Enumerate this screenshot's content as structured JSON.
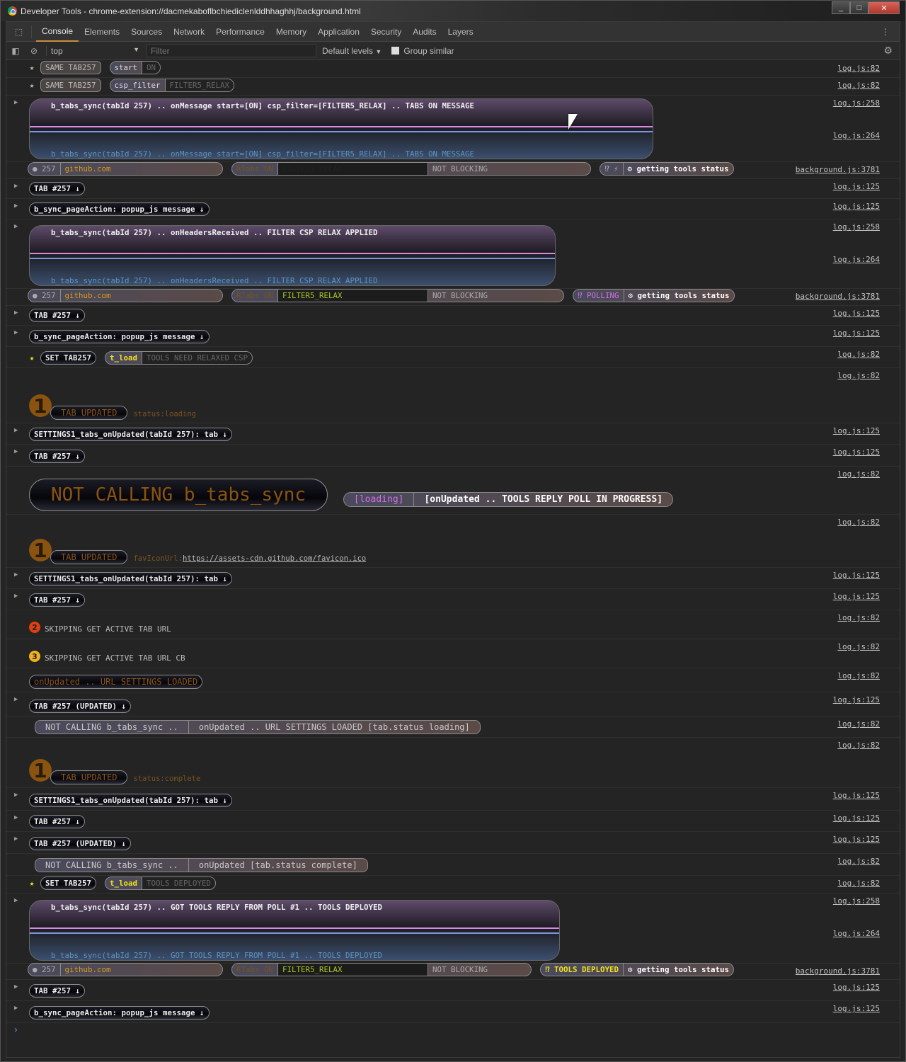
{
  "window": {
    "title": "Developer Tools - chrome-extension://dacmekaboflbchiediclenlddhhaghhj/background.html",
    "buttons": [
      "minimize",
      "maximize",
      "close"
    ]
  },
  "tabs": [
    "Console",
    "Elements",
    "Sources",
    "Network",
    "Performance",
    "Memory",
    "Application",
    "Security",
    "Audits",
    "Layers"
  ],
  "active_tab": "Console",
  "toolbar": {
    "context": "top",
    "filter_placeholder": "Filter",
    "levels": "Default levels",
    "group_similar": "Group similar",
    "group_similar_checked": false
  },
  "rows": [
    {
      "src": [
        "log.js:82"
      ],
      "parts": [
        {
          "t": "star",
          "color": "#bbbbbb"
        },
        {
          "t": "pill",
          "v": "gray",
          "text": "SAME TAB257"
        },
        {
          "t": "group",
          "segs": [
            {
              "text": "start"
            },
            {
              "text": "ON",
              "v": "dark"
            }
          ]
        }
      ]
    },
    {
      "src": [
        "log.js:82"
      ],
      "parts": [
        {
          "t": "star",
          "color": "#bbbbbb"
        },
        {
          "t": "pill",
          "v": "gray",
          "text": "SAME TAB257"
        },
        {
          "t": "group",
          "segs": [
            {
              "text": "csp_filter"
            },
            {
              "text": "FILTER5_RELAX",
              "v": "dark"
            }
          ]
        }
      ]
    },
    {
      "src": [
        "log.js:258",
        "log.js:264"
      ],
      "expand": true,
      "parts": [
        {
          "t": "block",
          "text": "b_tabs_sync(tabId 257) .. onMessage start=[ON] csp_filter=[FILTER5_RELAX] .. TABS ON MESSAGE"
        }
      ]
    },
    {
      "src": [
        "background.js:3781"
      ],
      "parts": [
        {
          "t": "status",
          "tab": "● 257",
          "host": "github.com",
          "rtabs": "RTabs ON",
          "filter": "FILTER5_RELAX",
          "filter_v": "c-dim",
          "block": "NOT BLOCKING",
          "state": "⁉ ⚡",
          "state_v": "c-gray",
          "tools": "⚙ getting tools status"
        }
      ]
    },
    {
      "src": [
        "log.js:125"
      ],
      "expand": true,
      "parts": [
        {
          "t": "pill",
          "text": "TAB #257 ↓"
        }
      ]
    },
    {
      "src": [
        "log.js:125"
      ],
      "expand": true,
      "parts": [
        {
          "t": "pill",
          "text": "b_sync_pageAction: popup_js message ↓"
        }
      ]
    },
    {
      "src": [
        "log.js:258",
        "log.js:264"
      ],
      "expand": true,
      "parts": [
        {
          "t": "block",
          "text": "b_tabs_sync(tabId 257) .. onHeadersReceived .. FILTER CSP RELAX APPLIED"
        }
      ]
    },
    {
      "src": [
        "background.js:3781"
      ],
      "parts": [
        {
          "t": "status",
          "tab": "● 257",
          "host": "github.com",
          "rtabs": "RTabs ON",
          "filter": "FILTER5_RELAX",
          "filter_v": "c-lime",
          "block": "NOT BLOCKING",
          "state": "⁉ POLLING",
          "state_v": "c-purple",
          "tools": "⚙ getting tools status"
        }
      ]
    },
    {
      "src": [
        "log.js:125"
      ],
      "expand": true,
      "parts": [
        {
          "t": "pill",
          "text": "TAB #257 ↓"
        }
      ]
    },
    {
      "src": [
        "log.js:125"
      ],
      "expand": true,
      "parts": [
        {
          "t": "pill",
          "text": "b_sync_pageAction: popup_js message ↓"
        }
      ]
    },
    {
      "src": [
        "log.js:82"
      ],
      "parts": [
        {
          "t": "star",
          "color": "#f0e020"
        },
        {
          "t": "pill",
          "text": "SET TAB257"
        },
        {
          "t": "group",
          "segs": [
            {
              "text": "t_load",
              "v": "c-yellow"
            },
            {
              "text": "TOOLS NEED RELAXED CSP",
              "v": "dark"
            }
          ]
        }
      ]
    },
    {
      "src": [
        "log.js:82"
      ],
      "parts": [
        {
          "t": "num",
          "text": "1"
        },
        {
          "t": "tabupdated",
          "text": "TAB UPDATED"
        },
        {
          "t": "small",
          "text": "status:loading"
        }
      ]
    },
    {
      "src": [
        "log.js:125"
      ],
      "expand": true,
      "parts": [
        {
          "t": "pill",
          "text": "SETTINGS1_tabs_onUpdated(tabId 257): tab ↓"
        }
      ]
    },
    {
      "src": [
        "log.js:125"
      ],
      "expand": true,
      "parts": [
        {
          "t": "pill",
          "text": "TAB #257 ↓"
        }
      ]
    },
    {
      "src": [
        "log.js:82"
      ],
      "parts": [
        {
          "t": "bignc",
          "text": "NOT CALLING b_tabs_sync"
        },
        {
          "t": "group",
          "big": true,
          "segs": [
            {
              "text": "[loading]",
              "v": "c-purple"
            },
            {
              "text": "[onUpdated .. TOOLS REPLY POLL IN PROGRESS]",
              "v": "bold"
            }
          ]
        }
      ]
    },
    {
      "src": [
        "log.js:82"
      ],
      "parts": [
        {
          "t": "num",
          "text": "1"
        },
        {
          "t": "tabupdated",
          "text": "TAB UPDATED"
        },
        {
          "t": "small",
          "text": "favIconUrl:",
          "link": "https://assets-cdn.github.com/favicon.ico"
        }
      ]
    },
    {
      "src": [
        "log.js:125"
      ],
      "expand": true,
      "parts": [
        {
          "t": "pill",
          "text": "SETTINGS1_tabs_onUpdated(tabId 257): tab ↓"
        }
      ]
    },
    {
      "src": [
        "log.js:125"
      ],
      "expand": true,
      "parts": [
        {
          "t": "pill",
          "text": "TAB #257 ↓"
        }
      ]
    },
    {
      "src": [
        "log.js:82"
      ],
      "parts": [
        {
          "t": "dot",
          "text": "2",
          "color": "#e04010"
        },
        {
          "t": "plain",
          "text": "SKIPPING GET ACTIVE TAB URL"
        }
      ]
    },
    {
      "src": [
        "log.js:82"
      ],
      "parts": [
        {
          "t": "dot",
          "text": "3",
          "color": "#f0b020"
        },
        {
          "t": "plain",
          "text": "SKIPPING GET ACTIVE TAB URL CB"
        }
      ]
    },
    {
      "src": [
        "log.js:82"
      ],
      "parts": [
        {
          "t": "urlpill",
          "text": "onUpdated .. URL SETTINGS LOADED"
        }
      ]
    },
    {
      "src": [
        "log.js:125"
      ],
      "expand": true,
      "parts": [
        {
          "t": "pill",
          "text": "TAB #257 (UPDATED) ↓"
        }
      ]
    },
    {
      "src": [
        "log.js:82"
      ],
      "parts": [
        {
          "t": "ncgroup",
          "segs": [
            {
              "text": "NOT CALLING b_tabs_sync .."
            },
            {
              "text": "onUpdated .. URL SETTINGS LOADED [tab.status loading]"
            }
          ]
        }
      ]
    },
    {
      "src": [
        "log.js:82"
      ],
      "parts": [
        {
          "t": "num",
          "text": "1"
        },
        {
          "t": "tabupdated",
          "text": "TAB UPDATED"
        },
        {
          "t": "small",
          "text": "status:complete"
        }
      ]
    },
    {
      "src": [
        "log.js:125"
      ],
      "expand": true,
      "parts": [
        {
          "t": "pill",
          "text": "SETTINGS1_tabs_onUpdated(tabId 257): tab ↓"
        }
      ]
    },
    {
      "src": [
        "log.js:125"
      ],
      "expand": true,
      "parts": [
        {
          "t": "pill",
          "text": "TAB #257 ↓"
        }
      ]
    },
    {
      "src": [
        "log.js:125"
      ],
      "expand": true,
      "parts": [
        {
          "t": "pill",
          "text": "TAB #257 (UPDATED) ↓"
        }
      ]
    },
    {
      "src": [
        "log.js:82"
      ],
      "parts": [
        {
          "t": "ncgroup",
          "segs": [
            {
              "text": "NOT CALLING b_tabs_sync .."
            },
            {
              "text": "onUpdated [tab.status complete]"
            }
          ]
        }
      ]
    },
    {
      "src": [
        "log.js:82"
      ],
      "parts": [
        {
          "t": "star",
          "color": "#f0e020"
        },
        {
          "t": "pill",
          "text": "SET TAB257"
        },
        {
          "t": "group",
          "segs": [
            {
              "text": "t_load",
              "v": "c-yellow"
            },
            {
              "text": "TOOLS DEPLOYED",
              "v": "dark"
            }
          ]
        }
      ]
    },
    {
      "src": [
        "log.js:258",
        "log.js:264"
      ],
      "expand": true,
      "parts": [
        {
          "t": "block",
          "text": "b_tabs_sync(tabId 257) .. GOT TOOLS REPLY FROM POLL #1 .. TOOLS DEPLOYED"
        }
      ]
    },
    {
      "src": [
        "background.js:3781"
      ],
      "parts": [
        {
          "t": "status",
          "tab": "● 257",
          "host": "github.com",
          "rtabs": "RTabs ON",
          "filter": "FILTER5_RELAX",
          "filter_v": "c-lime",
          "block": "NOT BLOCKING",
          "state": "⁉ TOOLS DEPLOYED",
          "state_v": "c-yellow",
          "tools": "⚙ getting tools status"
        }
      ]
    },
    {
      "src": [
        "log.js:125"
      ],
      "expand": true,
      "parts": [
        {
          "t": "pill",
          "text": "TAB #257 ↓"
        }
      ]
    },
    {
      "src": [
        "log.js:125"
      ],
      "expand": true,
      "parts": [
        {
          "t": "pill",
          "text": "b_sync_pageAction: popup_js message ↓"
        }
      ]
    }
  ],
  "prompt": "›"
}
